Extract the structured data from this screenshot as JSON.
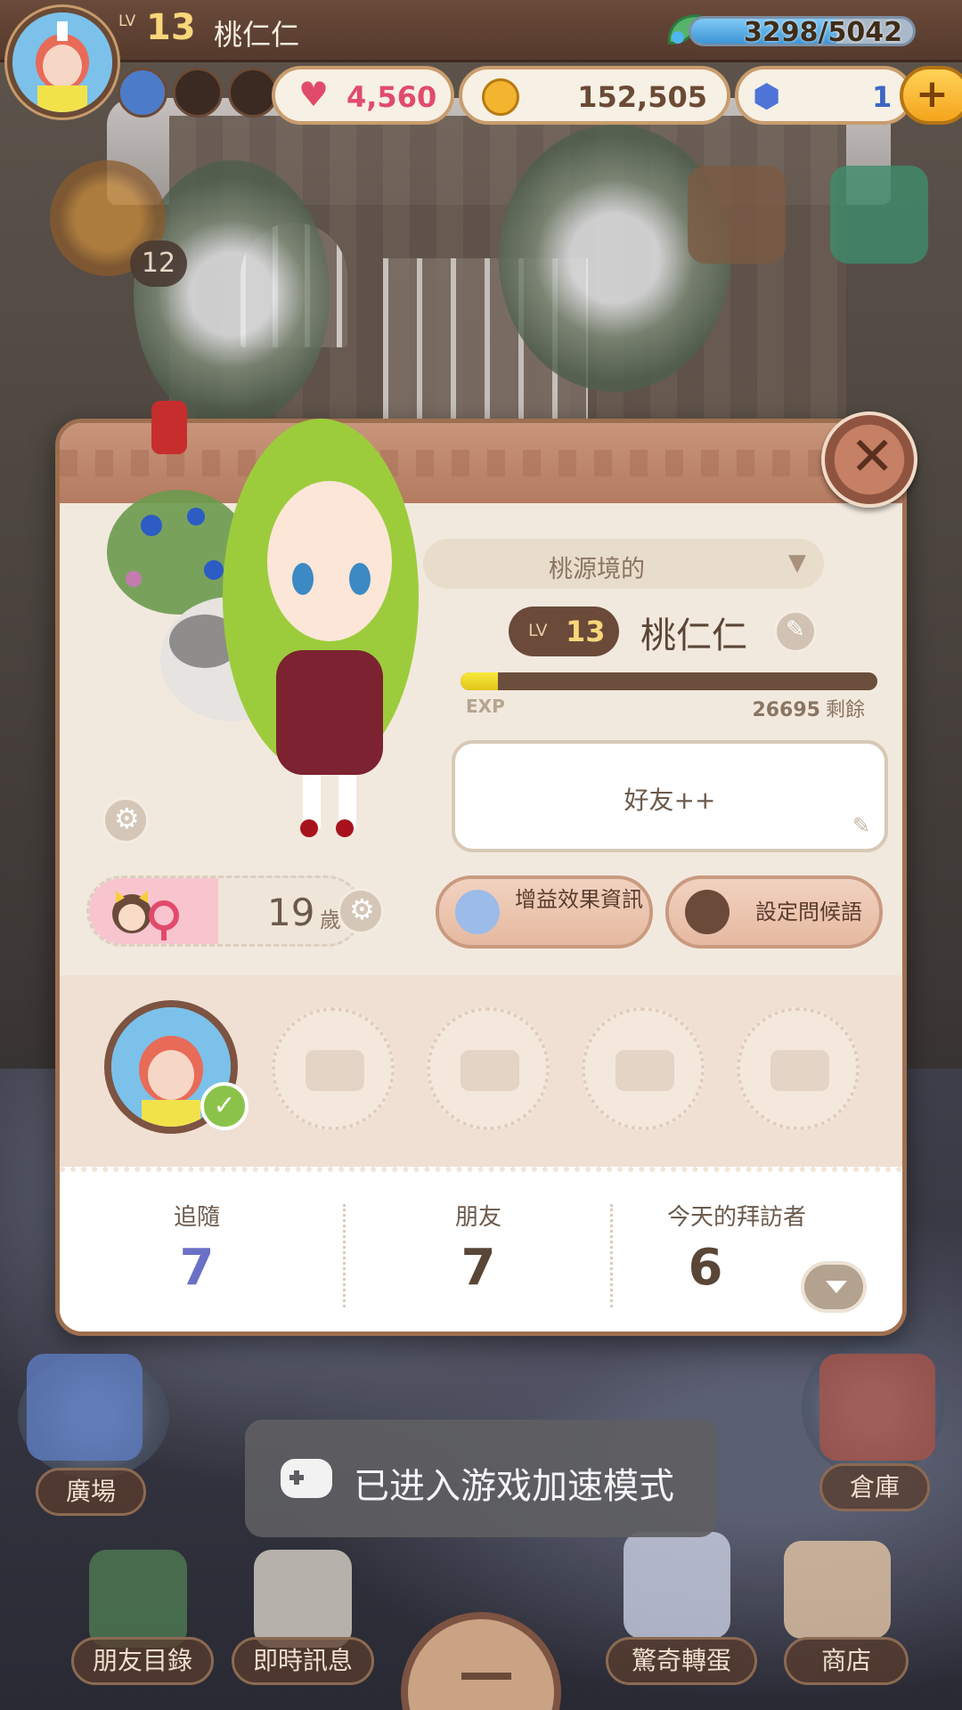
{
  "hud": {
    "level_label": "LV",
    "level": "13",
    "player_name": "桃仁仁",
    "energy_text": "3298/5042",
    "energy_fraction": 0.654,
    "hearts": "4,560",
    "coins": "152,505",
    "gems": "1"
  },
  "quest": {
    "count": "12"
  },
  "profile": {
    "region": "桃源境的",
    "level_label": "LV",
    "level": "13",
    "name": "桃仁仁",
    "exp_label": "EXP",
    "exp_fraction": 0.09,
    "exp_remaining": "26695",
    "exp_remaining_suffix": "剩餘",
    "greeting": "好友++",
    "age": "19",
    "age_unit": "歲",
    "buff_button": "增益效果資訊",
    "greeting_button": "設定問候語",
    "stats": [
      {
        "label": "追隨",
        "value": "7",
        "color": "#6a70c6"
      },
      {
        "label": "朋友",
        "value": "7",
        "color": "#5a4636"
      },
      {
        "label": "今天的拜訪者",
        "value": "6",
        "color": "#5a4636"
      }
    ]
  },
  "nav": {
    "plaza": "廣場",
    "storage": "倉庫",
    "friends_list": "朋友目錄",
    "messages": "即時訊息",
    "gacha": "驚奇轉蛋",
    "shop": "商店"
  },
  "toast": {
    "text": "已进入游戏加速模式"
  },
  "colors": {
    "accent_brown": "#6b4a3a",
    "follow_value": "#6a70c6",
    "exp_fill": "#f8ea3c"
  }
}
